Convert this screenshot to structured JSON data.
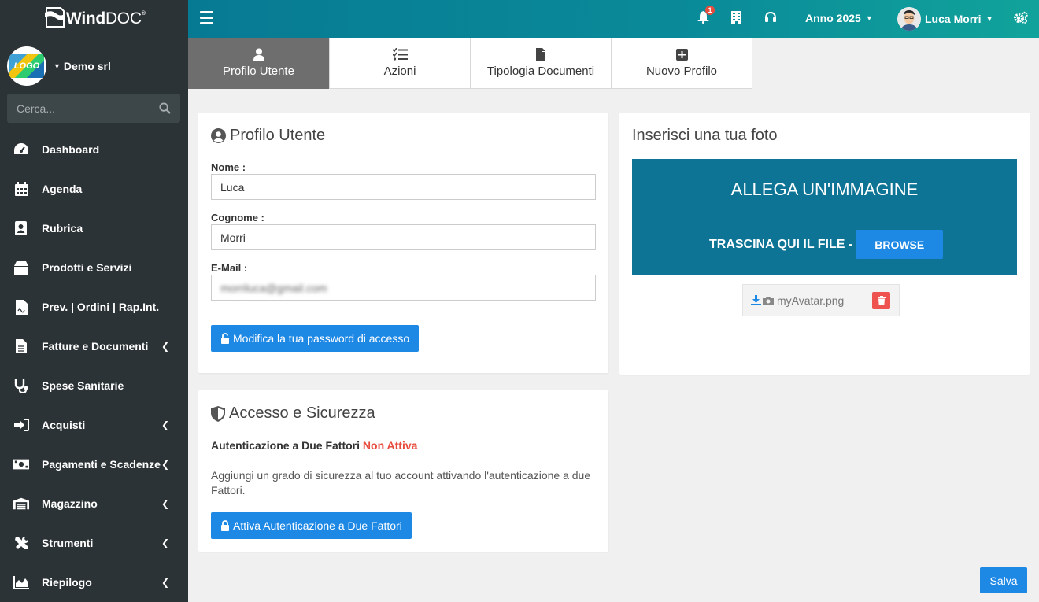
{
  "app": {
    "name_bold": "Wind",
    "name_light": "DOC",
    "reg": "®"
  },
  "company": {
    "name": "Demo srl",
    "logo_text": "LOGO"
  },
  "search": {
    "placeholder": "Cerca..."
  },
  "nav": [
    {
      "label": "Dashboard",
      "icon": "dashboard-icon",
      "submenu": false
    },
    {
      "label": "Agenda",
      "icon": "calendar-icon",
      "submenu": false
    },
    {
      "label": "Rubrica",
      "icon": "contact-book-icon",
      "submenu": false
    },
    {
      "label": "Prodotti e Servizi",
      "icon": "box-icon",
      "submenu": false
    },
    {
      "label": "Prev. | Ordini | Rap.Int.",
      "icon": "file-signature-icon",
      "submenu": false
    },
    {
      "label": "Fatture e Documenti",
      "icon": "invoice-icon",
      "submenu": true
    },
    {
      "label": "Spese Sanitarie",
      "icon": "stethoscope-icon",
      "submenu": false
    },
    {
      "label": "Acquisti",
      "icon": "sign-in-icon",
      "submenu": true
    },
    {
      "label": "Pagamenti e Scadenze",
      "icon": "money-bill-icon",
      "submenu": true
    },
    {
      "label": "Magazzino",
      "icon": "warehouse-icon",
      "submenu": true
    },
    {
      "label": "Strumenti",
      "icon": "tools-icon",
      "submenu": true
    },
    {
      "label": "Riepilogo",
      "icon": "area-chart-icon",
      "submenu": true
    }
  ],
  "topbar": {
    "notification_count": "1",
    "year_label": "Anno 2025",
    "user_name": "Luca Morri"
  },
  "tabs": [
    {
      "label": "Profilo Utente",
      "icon": "user-icon",
      "active": true
    },
    {
      "label": "Azioni",
      "icon": "tasks-icon",
      "active": false
    },
    {
      "label": "Tipologia Documenti",
      "icon": "file-icon",
      "active": false
    },
    {
      "label": "Nuovo Profilo",
      "icon": "plus-square-icon",
      "active": false
    }
  ],
  "profile": {
    "title": "Profilo Utente",
    "name_label": "Nome :",
    "name_value": "Luca",
    "surname_label": "Cognome :",
    "surname_value": "Morri",
    "email_label": "E-Mail :",
    "email_value": "morriluca@gmail.com",
    "password_button": "Modifica la tua password di accesso"
  },
  "security": {
    "title": "Accesso e Sicurezza",
    "twofa_label": "Autenticazione a Due Fattori",
    "twofa_status": "Non Attiva",
    "description": "Aggiungi un grado di sicurezza al tuo account attivando l'autenticazione a due Fattori.",
    "activate_button": "Attiva Autenticazione a Due Fattori"
  },
  "photo": {
    "title": "Inserisci una tua foto",
    "dropzone_title": "ALLEGA UN'IMMAGINE",
    "dropzone_text": "TRASCINA QUI IL FILE -",
    "browse_button": "BROWSE",
    "file_name": "myAvatar.png"
  },
  "save_button": "Salva",
  "colors": {
    "sidebar": "#2c3336",
    "topbar": "#0a8b99",
    "primary": "#1e88e5",
    "dropzone": "#0e7496",
    "danger": "#e74c3c"
  }
}
